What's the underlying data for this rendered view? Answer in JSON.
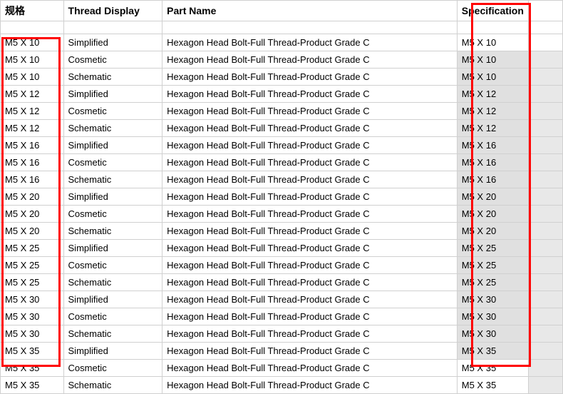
{
  "headers": {
    "spec": "规格",
    "thread_display": "Thread Display",
    "part_name": "Part Name",
    "specification": "Specification"
  },
  "rows": [
    {
      "spec": "M5 X 10",
      "thread": "Simplified",
      "part": "Hexagon Head Bolt-Full Thread-Product Grade C",
      "specification": "M5 X 10",
      "spec_shaded": false,
      "extra_shaded": false
    },
    {
      "spec": "M5 X 10",
      "thread": "Cosmetic",
      "part": "Hexagon Head Bolt-Full Thread-Product Grade C",
      "specification": "M5 X 10",
      "spec_shaded": true,
      "extra_shaded": true
    },
    {
      "spec": "M5 X 10",
      "thread": "Schematic",
      "part": "Hexagon Head Bolt-Full Thread-Product Grade C",
      "specification": "M5 X 10",
      "spec_shaded": true,
      "extra_shaded": true
    },
    {
      "spec": "M5 X 12",
      "thread": "Simplified",
      "part": "Hexagon Head Bolt-Full Thread-Product Grade C",
      "specification": "M5 X 12",
      "spec_shaded": true,
      "extra_shaded": true
    },
    {
      "spec": "M5 X 12",
      "thread": "Cosmetic",
      "part": "Hexagon Head Bolt-Full Thread-Product Grade C",
      "specification": "M5 X 12",
      "spec_shaded": true,
      "extra_shaded": true
    },
    {
      "spec": "M5 X 12",
      "thread": "Schematic",
      "part": "Hexagon Head Bolt-Full Thread-Product Grade C",
      "specification": "M5 X 12",
      "spec_shaded": true,
      "extra_shaded": true
    },
    {
      "spec": "M5 X 16",
      "thread": "Simplified",
      "part": "Hexagon Head Bolt-Full Thread-Product Grade C",
      "specification": "M5 X 16",
      "spec_shaded": true,
      "extra_shaded": true
    },
    {
      "spec": "M5 X 16",
      "thread": "Cosmetic",
      "part": "Hexagon Head Bolt-Full Thread-Product Grade C",
      "specification": "M5 X 16",
      "spec_shaded": true,
      "extra_shaded": true
    },
    {
      "spec": "M5 X 16",
      "thread": "Schematic",
      "part": "Hexagon Head Bolt-Full Thread-Product Grade C",
      "specification": "M5 X 16",
      "spec_shaded": true,
      "extra_shaded": true
    },
    {
      "spec": "M5 X 20",
      "thread": "Simplified",
      "part": "Hexagon Head Bolt-Full Thread-Product Grade C",
      "specification": "M5 X 20",
      "spec_shaded": true,
      "extra_shaded": true
    },
    {
      "spec": "M5 X 20",
      "thread": "Cosmetic",
      "part": "Hexagon Head Bolt-Full Thread-Product Grade C",
      "specification": "M5 X 20",
      "spec_shaded": true,
      "extra_shaded": true
    },
    {
      "spec": "M5 X 20",
      "thread": "Schematic",
      "part": "Hexagon Head Bolt-Full Thread-Product Grade C",
      "specification": "M5 X 20",
      "spec_shaded": true,
      "extra_shaded": true
    },
    {
      "spec": "M5 X 25",
      "thread": "Simplified",
      "part": "Hexagon Head Bolt-Full Thread-Product Grade C",
      "specification": "M5 X 25",
      "spec_shaded": true,
      "extra_shaded": true
    },
    {
      "spec": "M5 X 25",
      "thread": "Cosmetic",
      "part": "Hexagon Head Bolt-Full Thread-Product Grade C",
      "specification": "M5 X 25",
      "spec_shaded": true,
      "extra_shaded": true
    },
    {
      "spec": "M5 X 25",
      "thread": "Schematic",
      "part": "Hexagon Head Bolt-Full Thread-Product Grade C",
      "specification": "M5 X 25",
      "spec_shaded": true,
      "extra_shaded": true
    },
    {
      "spec": "M5 X 30",
      "thread": "Simplified",
      "part": "Hexagon Head Bolt-Full Thread-Product Grade C",
      "specification": "M5 X 30",
      "spec_shaded": true,
      "extra_shaded": true
    },
    {
      "spec": "M5 X 30",
      "thread": "Cosmetic",
      "part": "Hexagon Head Bolt-Full Thread-Product Grade C",
      "specification": "M5 X 30",
      "spec_shaded": true,
      "extra_shaded": true
    },
    {
      "spec": "M5 X 30",
      "thread": "Schematic",
      "part": "Hexagon Head Bolt-Full Thread-Product Grade C",
      "specification": "M5 X 30",
      "spec_shaded": true,
      "extra_shaded": true
    },
    {
      "spec": "M5 X 35",
      "thread": "Simplified",
      "part": "Hexagon Head Bolt-Full Thread-Product Grade C",
      "specification": "M5 X 35",
      "spec_shaded": true,
      "extra_shaded": true
    },
    {
      "spec": "M5 X 35",
      "thread": "Cosmetic",
      "part": "Hexagon Head Bolt-Full Thread-Product Grade C",
      "specification": "M5 X 35",
      "spec_shaded": false,
      "extra_shaded": true
    },
    {
      "spec": "M5 X 35",
      "thread": "Schematic",
      "part": "Hexagon Head Bolt-Full Thread-Product Grade C",
      "specification": "M5 X 35",
      "spec_shaded": false,
      "extra_shaded": true
    }
  ]
}
